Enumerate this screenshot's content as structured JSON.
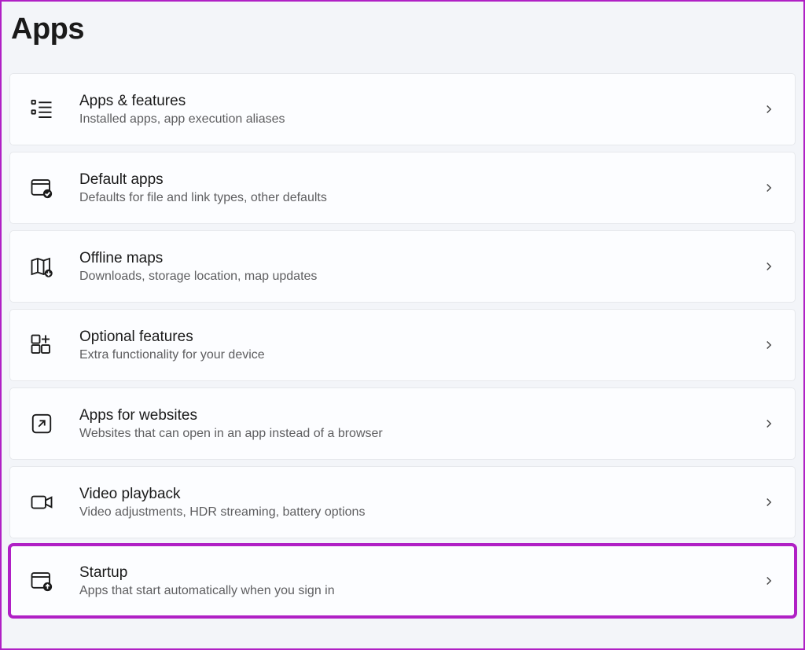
{
  "page": {
    "title": "Apps"
  },
  "items": [
    {
      "id": "apps-features",
      "title": "Apps & features",
      "subtitle": "Installed apps, app execution aliases",
      "highlighted": false
    },
    {
      "id": "default-apps",
      "title": "Default apps",
      "subtitle": "Defaults for file and link types, other defaults",
      "highlighted": false
    },
    {
      "id": "offline-maps",
      "title": "Offline maps",
      "subtitle": "Downloads, storage location, map updates",
      "highlighted": false
    },
    {
      "id": "optional-features",
      "title": "Optional features",
      "subtitle": "Extra functionality for your device",
      "highlighted": false
    },
    {
      "id": "apps-for-websites",
      "title": "Apps for websites",
      "subtitle": "Websites that can open in an app instead of a browser",
      "highlighted": false
    },
    {
      "id": "video-playback",
      "title": "Video playback",
      "subtitle": "Video adjustments, HDR streaming, battery options",
      "highlighted": false
    },
    {
      "id": "startup",
      "title": "Startup",
      "subtitle": "Apps that start automatically when you sign in",
      "highlighted": true
    }
  ]
}
